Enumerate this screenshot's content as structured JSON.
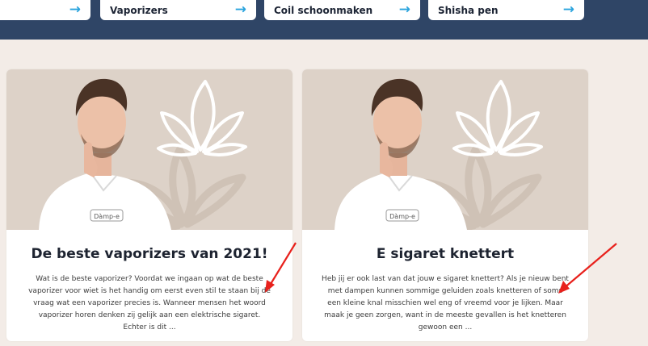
{
  "categories": [
    {
      "label": "",
      "arrow": "→"
    },
    {
      "label": "Vaporizers",
      "arrow": "→"
    },
    {
      "label": "Coil schoonmaken",
      "arrow": "→"
    },
    {
      "label": "Shisha pen",
      "arrow": "→"
    }
  ],
  "posts": [
    {
      "title": "De beste vaporizers van 2021!",
      "excerpt": "Wat is de beste vaporizer? Voordat we ingaan op wat de beste vaporizer voor wiet is het handig om eerst even stil te staan bij de vraag wat een vaporizer precies is. Wanneer mensen het woord vaporizer horen denken zij gelijk aan een elektrische sigaret. Echter is dit ...",
      "shirt_logo": "Dàmp-e"
    },
    {
      "title": "E sigaret knettert",
      "excerpt": "Heb jij er ook last van dat jouw e sigaret knettert? Als je nieuw bent met dampen kunnen sommige geluiden zoals knetteren of soms een kleine knal misschien wel eng of vreemd voor je lijken. Maar maak je geen zorgen, want in de meeste gevallen is het knetteren gewoon een ...",
      "shirt_logo": "Dàmp-e"
    }
  ],
  "colors": {
    "header_bg": "#2f4566",
    "page_bg": "#f3ece7",
    "image_bg": "#ddd2c8",
    "arrow": "#29a3dd",
    "annotation": "#e8211c"
  }
}
